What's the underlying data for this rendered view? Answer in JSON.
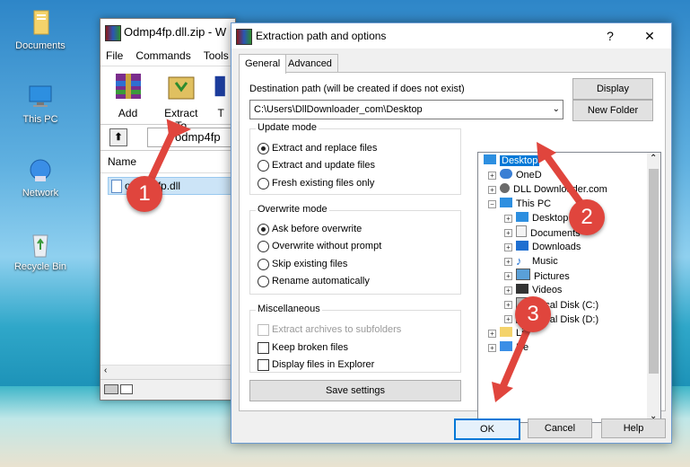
{
  "desktop": {
    "icons": [
      {
        "label": "Documents",
        "icon": "folder-icon"
      },
      {
        "label": "This PC",
        "icon": "computer-icon"
      },
      {
        "label": "Network",
        "icon": "network-icon"
      },
      {
        "label": "Recycle Bin",
        "icon": "recycle-bin-icon"
      }
    ]
  },
  "winrar": {
    "title": "Odmp4fp.dll.zip - W",
    "menu": [
      "File",
      "Commands",
      "Tools"
    ],
    "toolbar": {
      "add_label": "Add",
      "extract_label": "Extract To",
      "partial_label": "T"
    },
    "address": "odmp4fp",
    "list_header": "Name",
    "file_name": "odmp4fp.dll"
  },
  "dialog": {
    "title": "Extraction path and options",
    "help_glyph": "?",
    "close_glyph": "✕",
    "tabs": [
      "General",
      "Advanced"
    ],
    "destination_label": "Destination path (will be created if does not exist)",
    "destination_value": "C:\\Users\\DllDownloader_com\\Desktop",
    "display_button": "Display",
    "new_folder_button": "New Folder",
    "update_mode": {
      "title": "Update mode",
      "options": [
        "Extract and replace files",
        "Extract and update files",
        "Fresh existing files only"
      ],
      "selected": 0
    },
    "overwrite_mode": {
      "title": "Overwrite mode",
      "options": [
        "Ask before overwrite",
        "Overwrite without prompt",
        "Skip existing files",
        "Rename automatically"
      ],
      "selected": 0
    },
    "misc": {
      "title": "Miscellaneous",
      "options": [
        "Extract archives to subfolders",
        "Keep broken files",
        "Display files in Explorer"
      ]
    },
    "save_settings": "Save settings",
    "tree": {
      "items": [
        "Desktop",
        "OneD",
        "DLL Downloader.com",
        "This PC",
        "Desktop",
        "Documents",
        "Downloads",
        "Music",
        "Pictures",
        "Videos",
        "Local Disk (C:)",
        "Local Disk (D:)",
        "Li",
        "Ne"
      ]
    },
    "ok": "OK",
    "cancel": "Cancel",
    "help": "Help"
  },
  "annotations": {
    "step1": "1",
    "step2": "2",
    "step3": "3",
    "color": "#e0453d"
  }
}
